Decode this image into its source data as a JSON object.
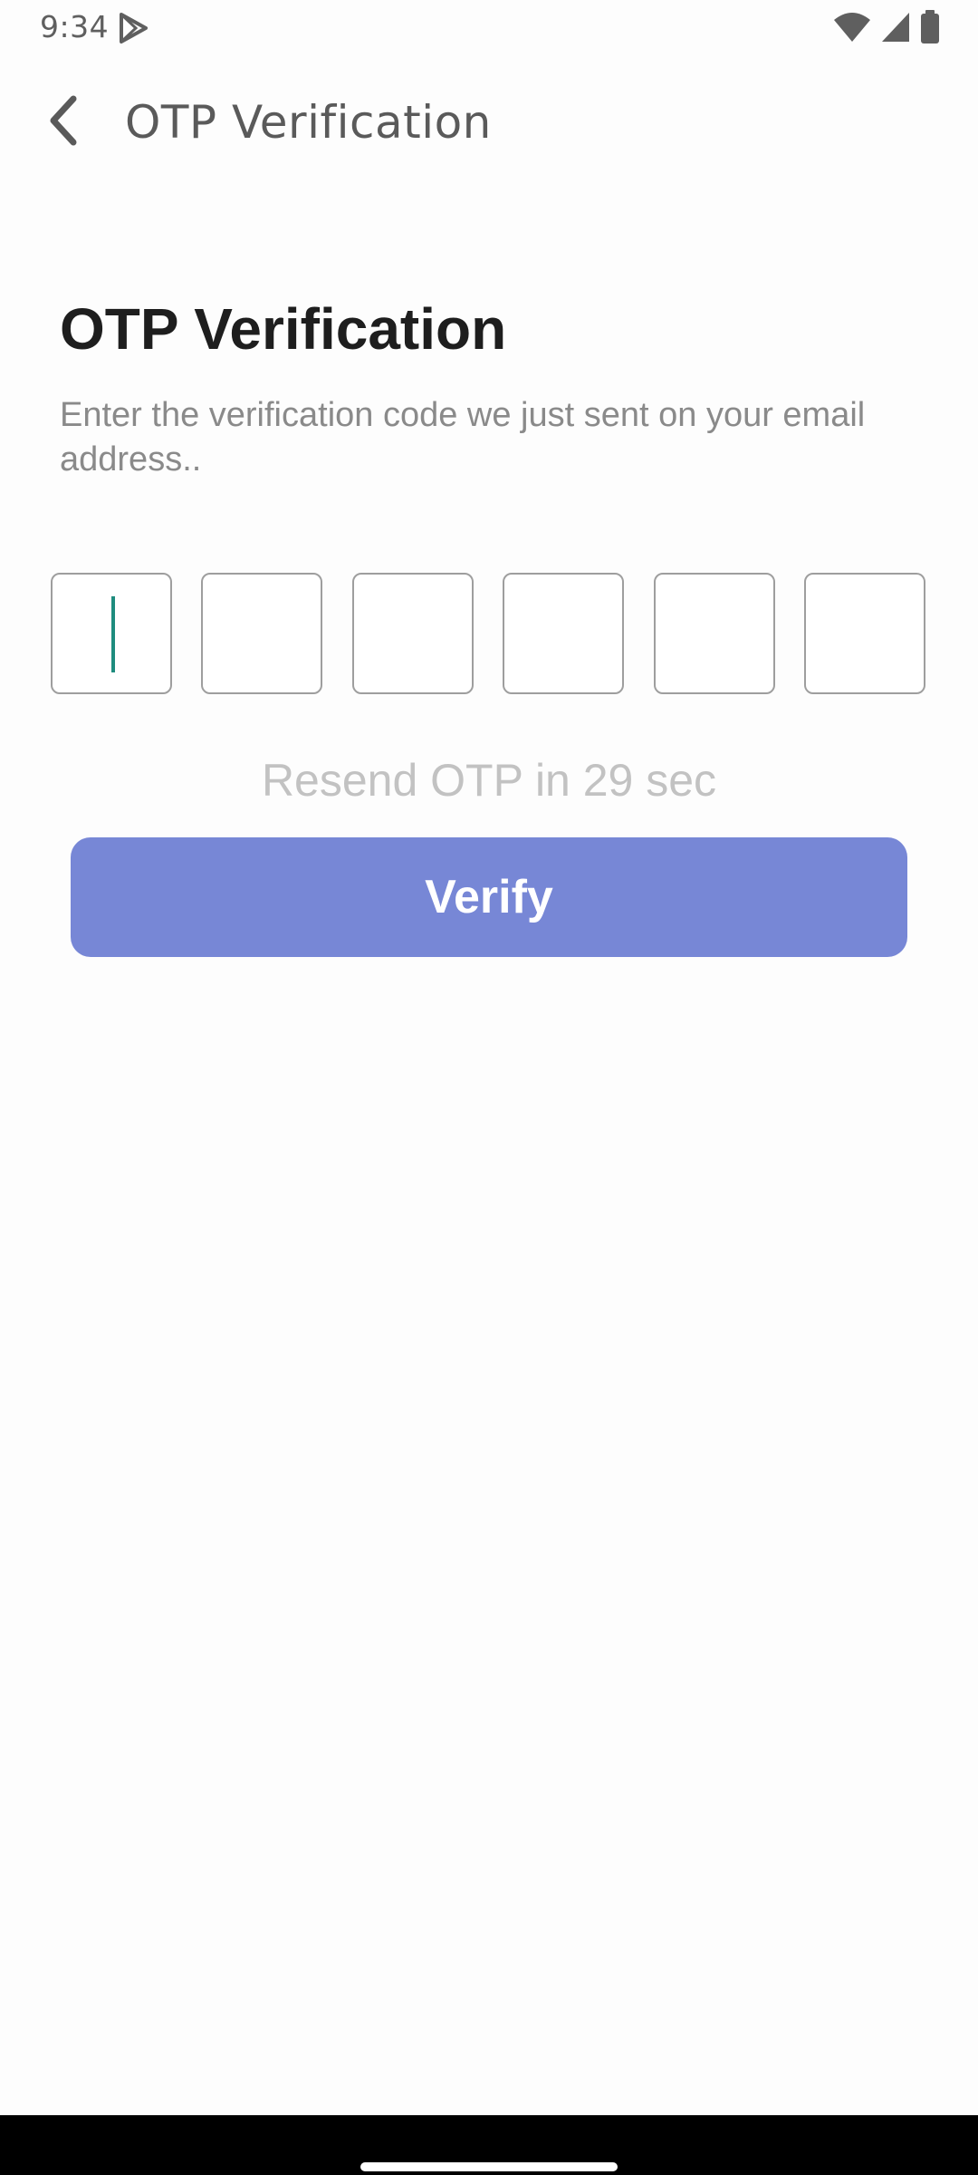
{
  "status_bar": {
    "time": "9:34",
    "icons": [
      "play-store-icon",
      "wifi-icon",
      "cell-signal-icon",
      "battery-icon"
    ]
  },
  "app_bar": {
    "back_icon": "chevron-left-icon",
    "title": "OTP Verification"
  },
  "content": {
    "heading": "OTP Verification",
    "subtitle": "Enter the verification code we just sent on your email address..",
    "otp": {
      "length": 6,
      "values": [
        "",
        "",
        "",
        "",
        "",
        ""
      ],
      "focused_index": 0
    },
    "resend_text": "Resend OTP in 29 sec",
    "verify_label": "Verify"
  },
  "colors": {
    "accent": "#7787d6",
    "cursor": "#1f8c7e",
    "heading": "#1e1e1e",
    "muted": "#8a8a8a",
    "disabled_text": "#c2c2c2"
  }
}
